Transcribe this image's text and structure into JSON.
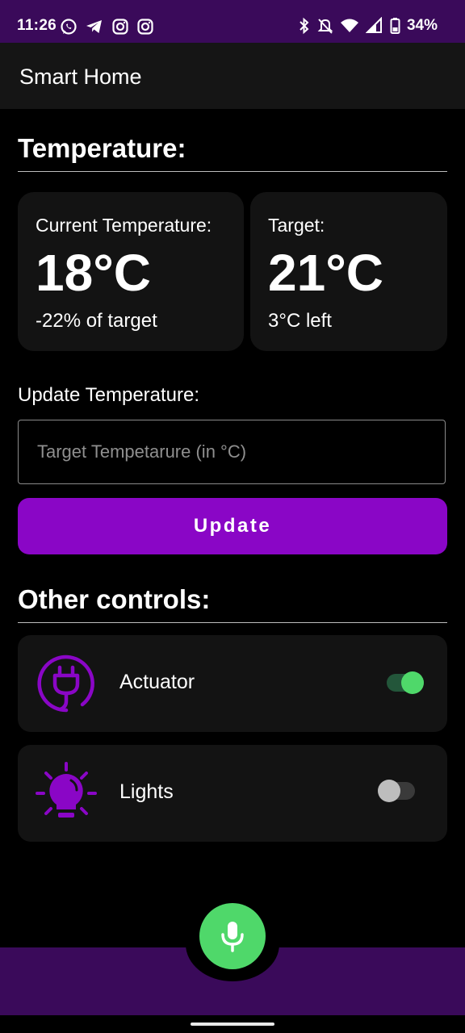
{
  "status_bar": {
    "time": "11:26",
    "battery": "34%",
    "left_icons": [
      "whatsapp-icon",
      "telegram-icon",
      "instagram-icon",
      "instagram-icon"
    ],
    "right_icons": [
      "bluetooth-icon",
      "mute-icon",
      "wifi-icon",
      "signal-icon",
      "battery-icon"
    ]
  },
  "app_bar": {
    "title": "Smart Home"
  },
  "temperature_section": {
    "title": "Temperature:",
    "current": {
      "label": "Current Temperature:",
      "value": "18°C",
      "sub": "-22% of target"
    },
    "target": {
      "label": "Target:",
      "value": "21°C",
      "sub": "3°C left"
    },
    "update_label": "Update Temperature:",
    "input_placeholder": "Target Tempetarure (in °C)",
    "update_button": "Update"
  },
  "controls_section": {
    "title": "Other controls:",
    "items": [
      {
        "label": "Actuator",
        "icon": "plug-icon",
        "on": true
      },
      {
        "label": "Lights",
        "icon": "lightbulb-icon",
        "on": false
      }
    ]
  },
  "fab": {
    "icon": "microphone-icon"
  },
  "colors": {
    "accent": "#8a06c6",
    "bar": "#3a0a5a",
    "card": "#131313",
    "switch_on": "#4fd86a",
    "fab": "#4fd86a"
  }
}
